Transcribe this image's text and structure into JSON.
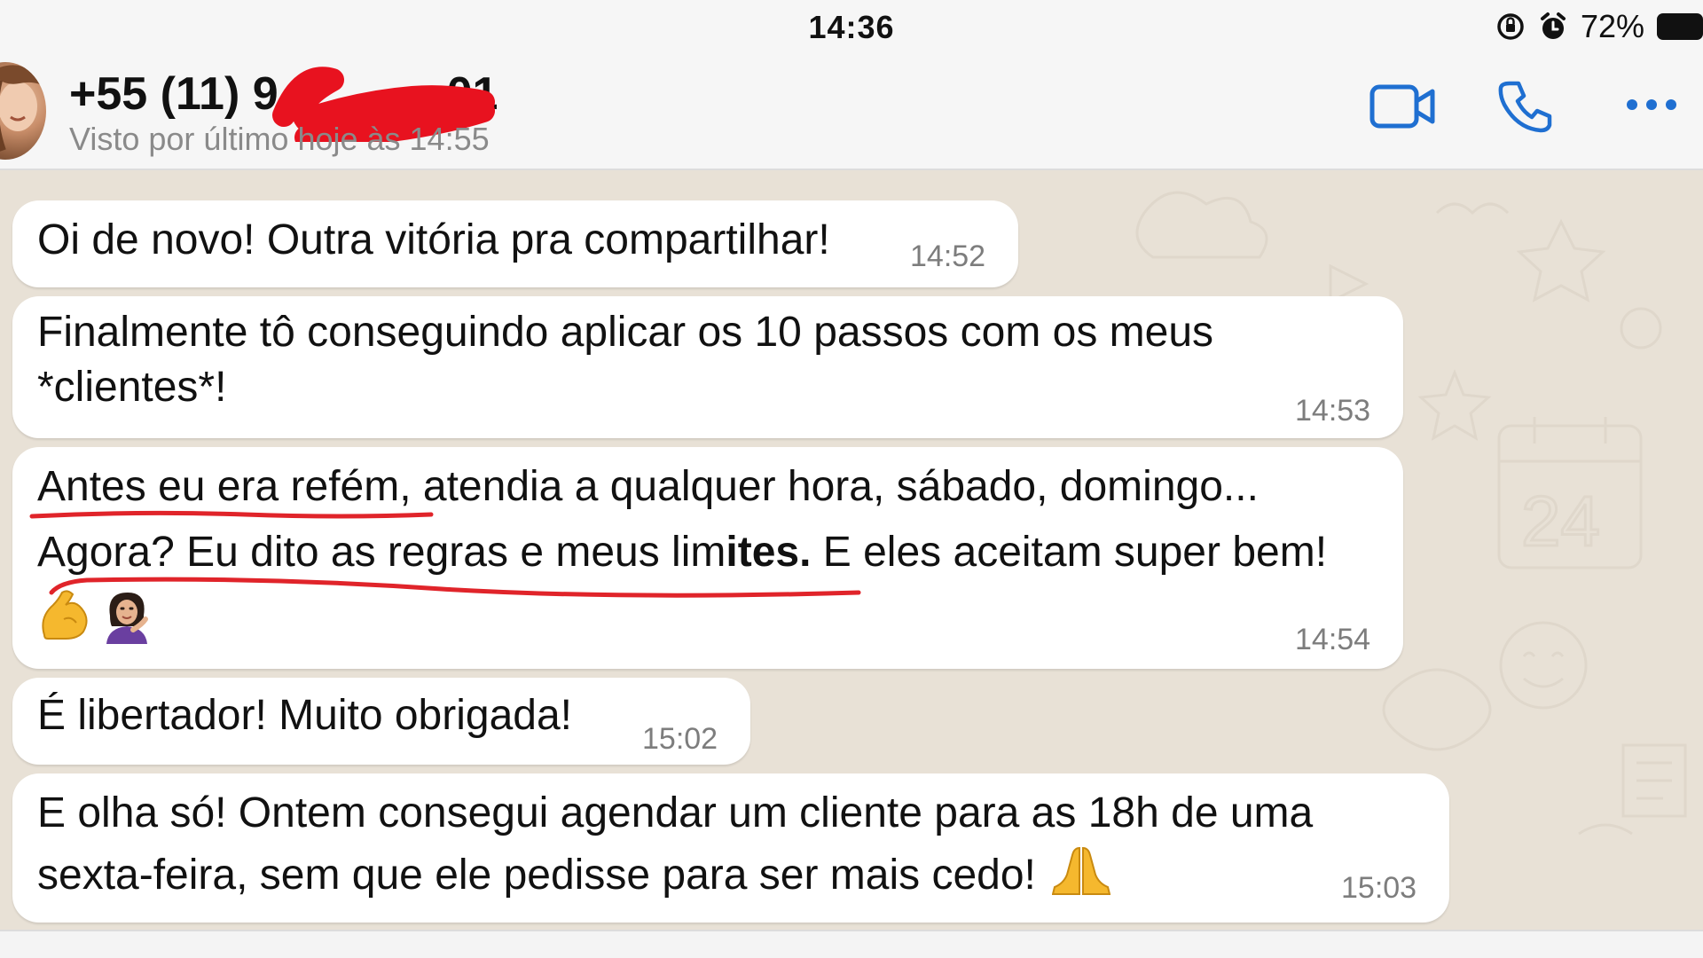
{
  "status_bar": {
    "time": "14:36",
    "battery_percent": "72%",
    "icons": [
      "screen-rotation-lock-icon",
      "alarm-icon",
      "battery-icon"
    ]
  },
  "header": {
    "contact_number": "+55 (11) 9",
    "contact_number_end": "01",
    "last_seen": "Visto por último hoje às 14:55",
    "actions": [
      "video-call-icon",
      "phone-icon",
      "more-options-icon"
    ]
  },
  "messages": [
    {
      "lines": [
        "Oi de novo! Outra vitória pra compartilhar!"
      ],
      "time": "14:52"
    },
    {
      "lines": [
        "Finalmente tô conseguindo aplicar os 10 passos com os meus",
        "*clientes*!"
      ],
      "time": "14:53"
    },
    {
      "line1_underlined": "Antes eu era refém",
      "line1_rest": ", atendia a qualquer hora, sábado, domingo...",
      "line2_underlined_a": "Agora? Eu dito as regras e meus lim",
      "line2_bold": "ites.",
      "line2_rest": " E eles aceitam super bem!",
      "emojis": [
        "flexed-biceps-emoji",
        "woman-tipping-hand-emoji"
      ],
      "time": "14:54"
    },
    {
      "lines": [
        "É libertador! Muito obrigada!"
      ],
      "time": "15:02"
    },
    {
      "lines": [
        "E olha só! Ontem consegui agendar um cliente para as 18h de uma",
        "sexta-feira, sem que ele pedisse para ser mais cedo!"
      ],
      "emoji": "folded-hands-emoji",
      "time": "15:03"
    }
  ],
  "colors": {
    "wallpaper": "#e8e1d6",
    "bubble": "#ffffff",
    "accent_blue": "#1f6fd1",
    "underline_red": "#e0242a",
    "redaction_red": "#e8121f",
    "time_gray": "#7d7d7d"
  }
}
